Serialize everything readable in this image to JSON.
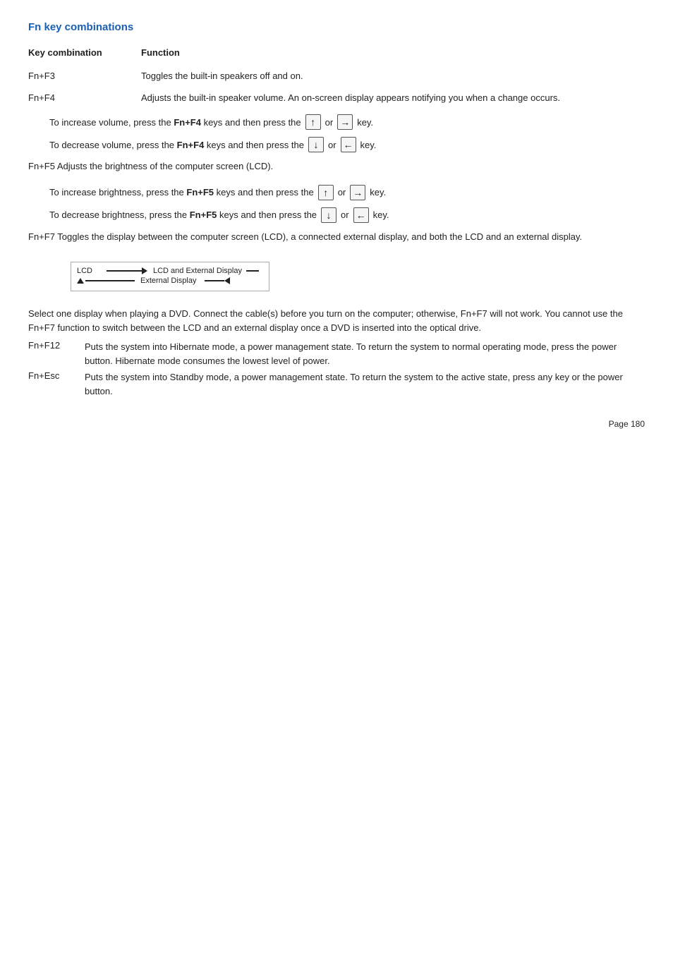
{
  "title": "Fn key combinations",
  "header": {
    "key_combination": "Key combination",
    "function": "Function"
  },
  "sections": [
    {
      "key": "Fn+F3",
      "description": "Toggles the built-in speakers off and on."
    },
    {
      "key": "Fn+F4",
      "description": "Adjusts the built-in speaker volume. An on-screen display appears notifying you when a change occurs."
    }
  ],
  "increase_volume": "To increase volume, press the ",
  "increase_volume_keys": "Fn+F4",
  "increase_volume_mid": " keys and then press the ",
  "increase_volume_end": " key.",
  "decrease_volume": "To decrease volume, press the ",
  "decrease_volume_keys": "Fn+F4",
  "decrease_volume_mid": " keys and then press the ",
  "decrease_volume_end": " key.",
  "fn_f5_desc": "Fn+F5  Adjusts the brightness of the computer screen (LCD).",
  "increase_brightness": "To increase brightness, press the ",
  "increase_brightness_keys": "Fn+F5",
  "increase_brightness_mid": " keys and then press the ",
  "increase_brightness_end": " key.",
  "decrease_brightness": "To decrease brightness, press the ",
  "decrease_brightness_keys": "Fn+F5",
  "decrease_brightness_mid": " keys and then press the ",
  "decrease_brightness_end": " key.",
  "fn_f7_desc": "Fn+F7  Toggles the display between the computer screen (LCD), a connected external display, and both the LCD and an external display.",
  "lcd_label": "LCD",
  "lcd_and_ext": "LCD and External Display",
  "ext_display": "External Display",
  "select_dvd": "Select one display when playing a DVD. Connect the cable(s) before you turn on the computer; otherwise, Fn+F7 will not work. You cannot use the Fn+F7 function to switch between the LCD and an external display once a DVD is inserted into the optical drive.",
  "fn_f12_key": "Fn+F12",
  "fn_f12_desc": "Puts the system into Hibernate mode, a power management state. To return the system to normal operating mode, press the power button. Hibernate mode consumes the lowest level of power.",
  "fn_esc_key": "Fn+Esc",
  "fn_esc_desc": "Puts the system into Standby mode, a power management state. To return the system to the active state, press any key or the power button.",
  "page_number": "Page 180"
}
